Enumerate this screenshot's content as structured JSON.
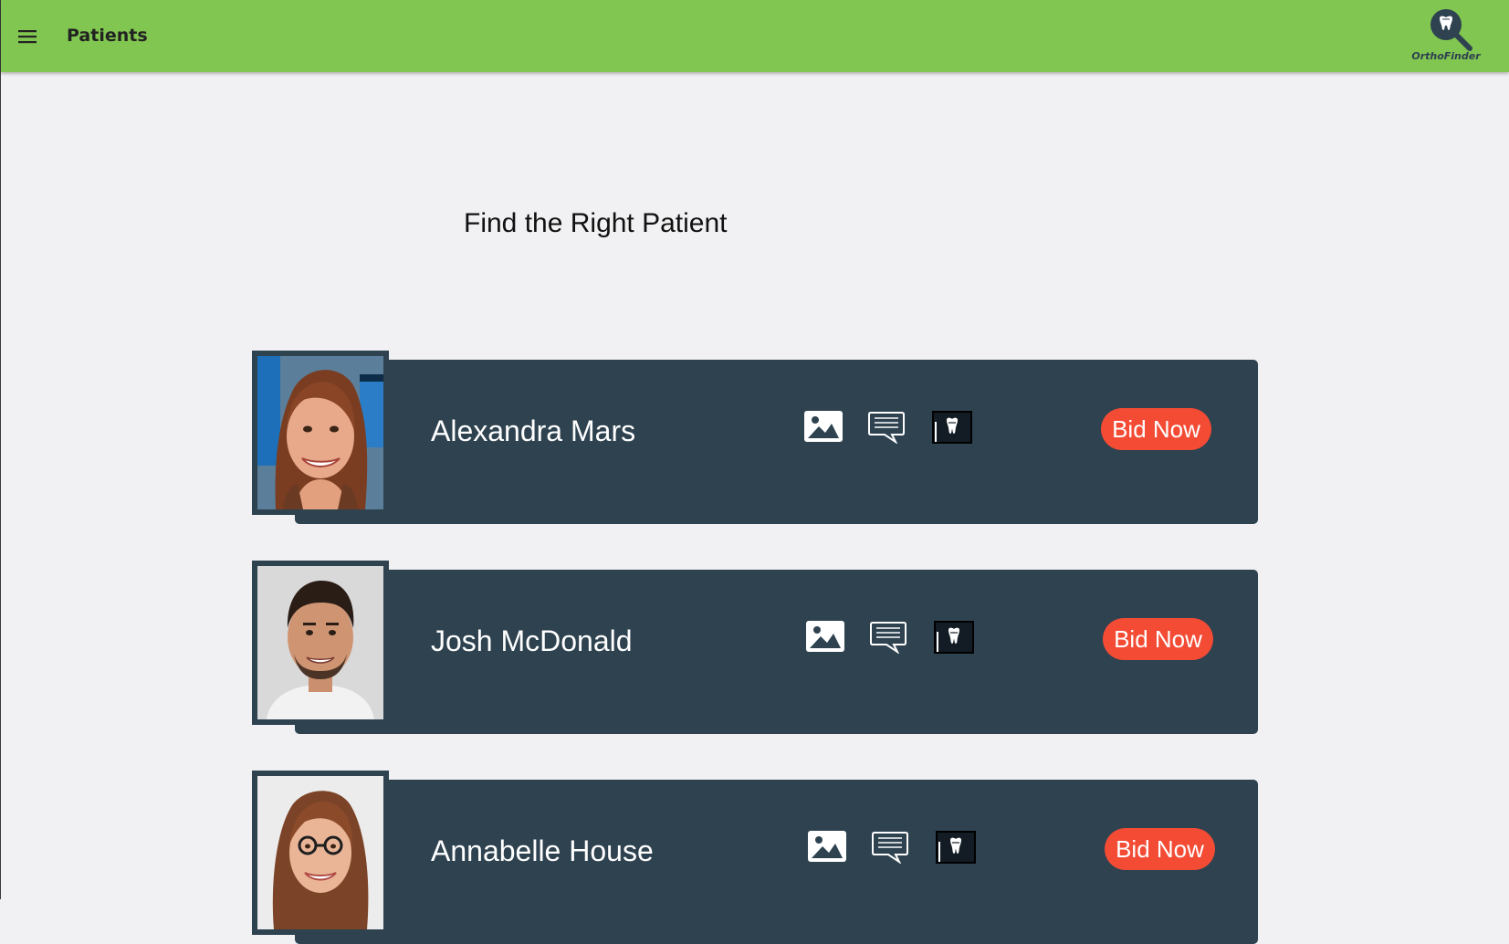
{
  "appbar": {
    "title": "Patients",
    "menu_icon": "hamburger-menu-icon",
    "logo_text": "OrthoFinder",
    "background": "#81c650"
  },
  "main": {
    "heading": "Find the Right Patient"
  },
  "patients": [
    {
      "name": "Alexandra Mars",
      "bid_label": "Bid Now"
    },
    {
      "name": "Josh McDonald",
      "bid_label": "Bid Now"
    },
    {
      "name": "Annabelle House",
      "bid_label": "Bid Now"
    }
  ],
  "icons": {
    "photos": "image-icon",
    "notes": "chat-bubble-icon",
    "xray": "tooth-xray-icon"
  },
  "colors": {
    "card": "#2e4250",
    "bid_button": "#f44b35",
    "page_background": "#f1f1f3"
  }
}
